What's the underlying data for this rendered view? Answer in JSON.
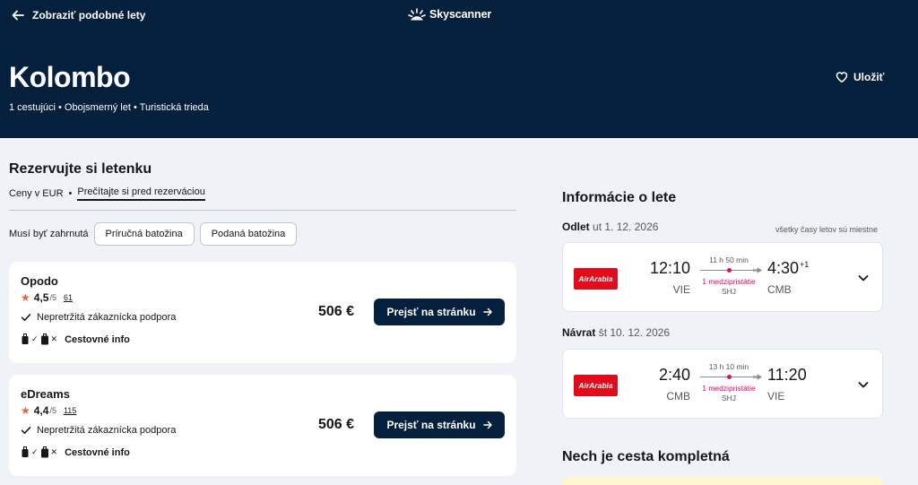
{
  "header": {
    "back_label": "Zobraziť podobné lety",
    "brand": "Skyscanner",
    "title": "Kolombo",
    "subtitle": "1 cestujúci • Obojsmerný let • Turistická trieda",
    "save_label": "Uložiť"
  },
  "booking": {
    "title": "Rezervujte si letenku",
    "currency_note": "Ceny v EUR",
    "bullet": "•",
    "read_link": "Prečítajte si pred rezerváciou",
    "filter_label": "Musí byť zahrnutá",
    "filters": [
      "Príručná batožina",
      "Podaná batožina"
    ],
    "providers": [
      {
        "name": "Opodo",
        "rating": "4,5",
        "rating_of": "/5",
        "reviews": "61",
        "support": "Nepretržitá zákaznícka podpora",
        "bags_label": "Cestovné info",
        "price": "506 €",
        "button": "Prejsť na stránku"
      },
      {
        "name": "eDreams",
        "rating": "4,4",
        "rating_of": "/5",
        "reviews": "115",
        "support": "Nepretržitá zákaznícka podpora",
        "bags_label": "Cestovné info",
        "price": "506 €",
        "button": "Prejsť na stránku"
      }
    ]
  },
  "flight_info": {
    "title": "Informácie o lete",
    "local_times_note": "všetky časy letov sú miestne",
    "legs": [
      {
        "label": "Odlet",
        "date": "ut 1. 12. 2026",
        "airline": "AirArabia",
        "dep_time": "12:10",
        "dep_code": "VIE",
        "duration": "11 h 50 min",
        "stops": "1 medzipristátie",
        "via": "SHJ",
        "arr_time": "4:30",
        "arr_offset": "+1",
        "arr_code": "CMB"
      },
      {
        "label": "Návrat",
        "date": "št 10. 12. 2026",
        "airline": "AirArabia",
        "dep_time": "2:40",
        "dep_code": "CMB",
        "duration": "13 h 10 min",
        "stops": "1 medzipristátie",
        "via": "SHJ",
        "arr_time": "11:20",
        "arr_offset": "",
        "arr_code": "VIE"
      }
    ],
    "complete_title": "Nech je cesta kompletná"
  },
  "colors": {
    "header_bg": "#05203c",
    "accent_pink": "#e70866",
    "star": "#e8623c",
    "airline_red": "#e20b1b"
  }
}
